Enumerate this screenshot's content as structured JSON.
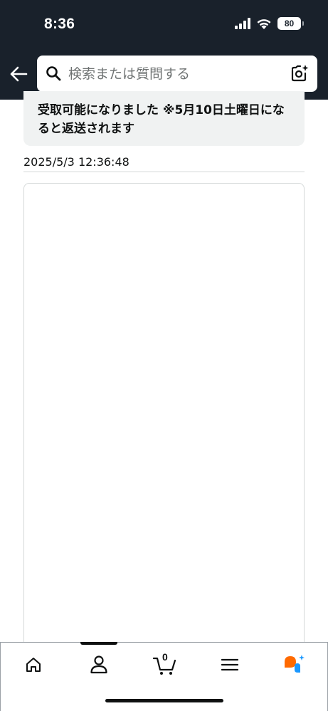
{
  "status_bar": {
    "time": "8:36",
    "battery": "80"
  },
  "search": {
    "placeholder": "検索または質問する"
  },
  "message": {
    "text": "受取可能になりました ※5月10日土曜日になると返送されます"
  },
  "timestamp": "2025/5/3 12:36:48",
  "nav": {
    "cart_count": "0",
    "items": [
      "home-icon",
      "account-icon",
      "cart-icon",
      "menu-icon",
      "rufus-icon"
    ]
  },
  "colors": {
    "header_bg": "#19212b",
    "message_bg": "#f0f2f2",
    "rufus_orange": "#ff6a00",
    "rufus_blue": "#1a98ff"
  }
}
